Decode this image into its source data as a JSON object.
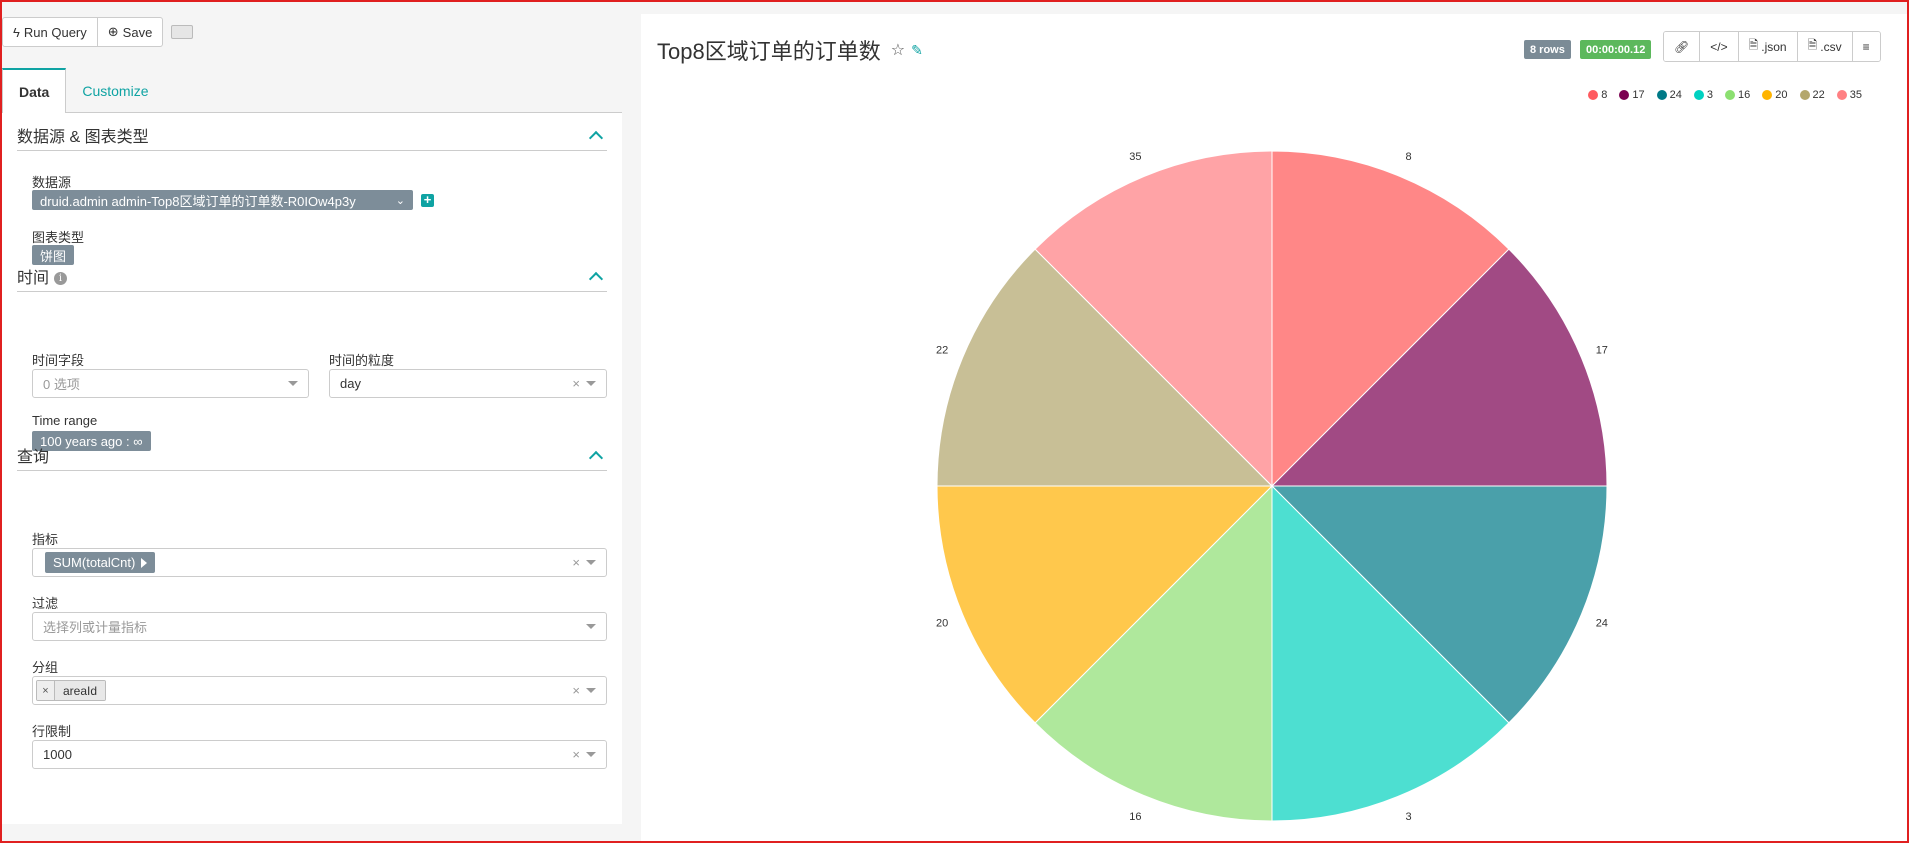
{
  "toolbar": {
    "run_label": "Run Query",
    "save_label": "Save"
  },
  "tabs": [
    {
      "label": "Data"
    },
    {
      "label": "Customize"
    }
  ],
  "sections": {
    "datasource": {
      "title": "数据源 & 图表类型",
      "datasource_label": "数据源",
      "datasource_value": "druid.admin admin-Top8区域订单的订单数-R0IOw4p3y",
      "viz_label": "图表类型",
      "viz_value": "饼图"
    },
    "time": {
      "title": "时间",
      "time_field_label": "时间字段",
      "time_field_placeholder": "0 选项",
      "granularity_label": "时间的粒度",
      "granularity_value": "day",
      "range_label": "Time range",
      "range_value": "100 years ago : ∞"
    },
    "query": {
      "title": "查询",
      "metrics_label": "指标",
      "metric_value": "SUM(totalCnt)",
      "filter_label": "过滤",
      "filter_placeholder": "选择列或计量指标",
      "groupby_label": "分组",
      "groupby_value": "areaId",
      "row_limit_label": "行限制",
      "row_limit_value": "1000"
    }
  },
  "chart_header": {
    "title": "Top8区域订单的订单数",
    "rows_badge": "8 rows",
    "time_badge": "00:00:00.12",
    "rows_badge_color": "#7b8b96",
    "time_badge_color": "#5cb85c",
    "json_label": ".json",
    "csv_label": ".csv"
  },
  "chart_data": {
    "type": "pie",
    "categories": [
      "8",
      "17",
      "24",
      "3",
      "16",
      "20",
      "22",
      "35"
    ],
    "values": [
      1,
      1,
      1,
      1,
      1,
      1,
      1,
      1
    ],
    "colors": [
      "#ff8787",
      "#a14a84",
      "#4aa0aa",
      "#4ddfd1",
      "#afe89c",
      "#ffc84c",
      "#c8bf96",
      "#ffa3a6"
    ],
    "legend_colors": [
      "#ff5a5f",
      "#7b0051",
      "#007a87",
      "#00d1c1",
      "#8ce071",
      "#ffb400",
      "#b4a76c",
      "#ff8083"
    ],
    "legend_position": "top-right"
  }
}
